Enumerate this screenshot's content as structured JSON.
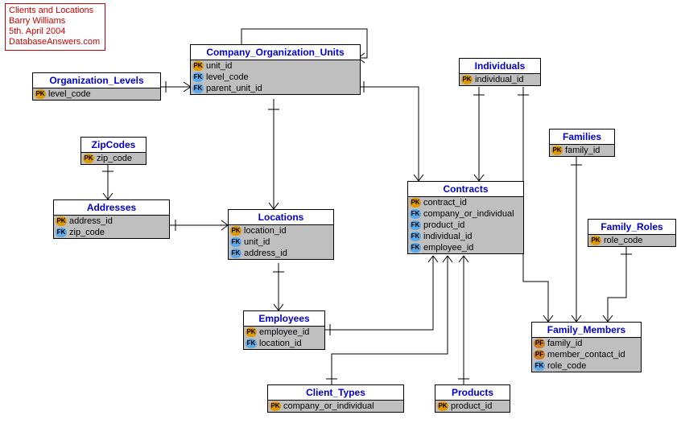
{
  "meta": {
    "title": "Clients and Locations",
    "author": "Barry Williams",
    "date": "5th. April 2004",
    "site": "DatabaseAnswers.com"
  },
  "entities": {
    "org_levels": {
      "title": "Organization_Levels",
      "attrs": [
        {
          "key": "PK",
          "name": "level_code"
        }
      ]
    },
    "company_org_units": {
      "title": "Company_Organization_Units",
      "attrs": [
        {
          "key": "PK",
          "name": "unit_id"
        },
        {
          "key": "FK",
          "name": "level_code"
        },
        {
          "key": "FK",
          "name": "parent_unit_id"
        }
      ]
    },
    "zipcodes": {
      "title": "ZipCodes",
      "attrs": [
        {
          "key": "PK",
          "name": "zip_code"
        }
      ]
    },
    "addresses": {
      "title": "Addresses",
      "attrs": [
        {
          "key": "PK",
          "name": "address_id"
        },
        {
          "key": "FK",
          "name": "zip_code"
        }
      ]
    },
    "locations": {
      "title": "Locations",
      "attrs": [
        {
          "key": "PK",
          "name": "location_id"
        },
        {
          "key": "FK",
          "name": "unit_id"
        },
        {
          "key": "FK",
          "name": "address_id"
        }
      ]
    },
    "employees": {
      "title": "Employees",
      "attrs": [
        {
          "key": "PK",
          "name": "employee_id"
        },
        {
          "key": "FK",
          "name": "location_id"
        }
      ]
    },
    "client_types": {
      "title": "Client_Types",
      "attrs": [
        {
          "key": "PK",
          "name": "company_or_individual"
        }
      ]
    },
    "contracts": {
      "title": "Contracts",
      "attrs": [
        {
          "key": "PK",
          "name": "contract_id"
        },
        {
          "key": "FK",
          "name": "company_or_individual"
        },
        {
          "key": "FK",
          "name": "product_id"
        },
        {
          "key": "FK",
          "name": "individual_id"
        },
        {
          "key": "FK",
          "name": "employee_id"
        }
      ]
    },
    "products": {
      "title": "Products",
      "attrs": [
        {
          "key": "PK",
          "name": "product_id"
        }
      ]
    },
    "individuals": {
      "title": "Individuals",
      "attrs": [
        {
          "key": "PK",
          "name": "individual_id"
        }
      ]
    },
    "families": {
      "title": "Families",
      "attrs": [
        {
          "key": "PK",
          "name": "family_id"
        }
      ]
    },
    "family_roles": {
      "title": "Family_Roles",
      "attrs": [
        {
          "key": "PK",
          "name": "role_code"
        }
      ]
    },
    "family_members": {
      "title": "Family_Members",
      "attrs": [
        {
          "key": "PF",
          "name": "family_id"
        },
        {
          "key": "PF",
          "name": "member_contact_id"
        },
        {
          "key": "FK",
          "name": "role_code"
        }
      ]
    }
  }
}
